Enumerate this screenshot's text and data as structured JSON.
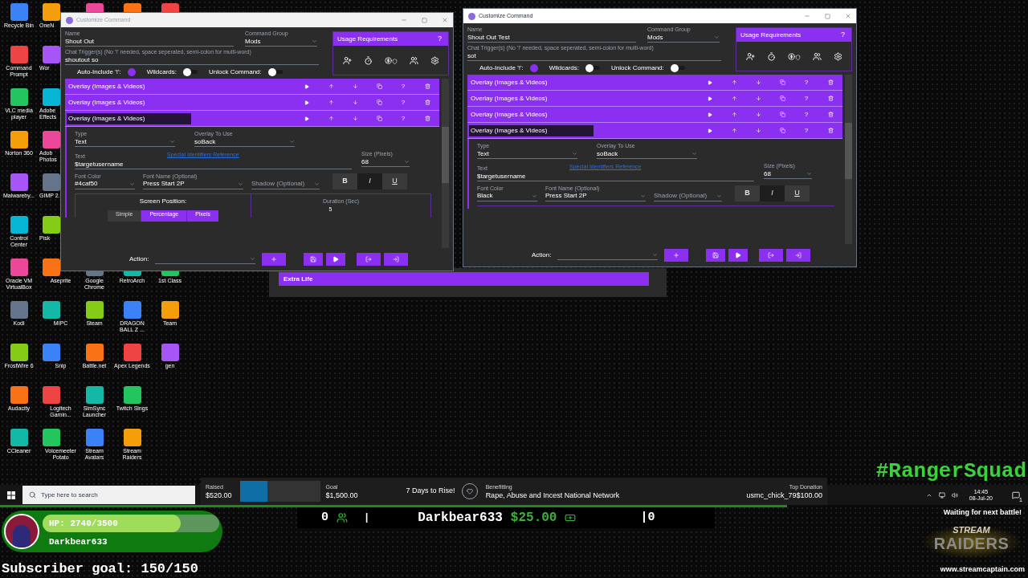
{
  "desktop_columns": [
    [
      {
        "label": "Recycle Bin"
      },
      {
        "label": "Command Prompt"
      },
      {
        "label": "VLC media player"
      },
      {
        "label": "Norton 360"
      },
      {
        "label": "Malwareby..."
      },
      {
        "label": "Control Center"
      },
      {
        "label": "Oracle VM VirtualBox"
      },
      {
        "label": "Kodi"
      },
      {
        "label": "FrostWire 6"
      },
      {
        "label": "Audacity"
      },
      {
        "label": "CCleaner"
      }
    ],
    [
      {
        "label": "OneN"
      },
      {
        "label": "Wor"
      },
      {
        "label": "Adobe Effects"
      },
      {
        "label": "Adob Photos"
      },
      {
        "label": "GIMP 2."
      },
      {
        "label": "Pisk"
      },
      {
        "label": "Aseprite"
      },
      {
        "label": "MIPC"
      },
      {
        "label": "Snip"
      },
      {
        "label": "Logitech Gamin..."
      },
      {
        "label": "Voicemeeter Potato"
      }
    ],
    [
      {},
      {
        "label": "Google Chrome"
      },
      {
        "label": "Steam"
      },
      {
        "label": "Battle.net"
      },
      {
        "label": "SimSync Launcher"
      },
      {
        "label": "Stream Avatars"
      }
    ],
    [
      {},
      {
        "label": "RetroArch"
      },
      {
        "label": "DRAGON BALL Z ..."
      },
      {
        "label": "Apex Legends"
      },
      {
        "label": "Twitch Sings"
      },
      {
        "label": "Stream Raiders"
      }
    ],
    [
      {},
      {
        "label": "1st Class"
      },
      {
        "label": "Team"
      },
      {
        "label": "gen"
      }
    ]
  ],
  "background_bar": {
    "label": "Extra Life"
  },
  "windows": [
    {
      "title": "Customize Command",
      "active": false,
      "name_label": "Name",
      "name": "Shout Out",
      "group_label": "Command Group",
      "group": "Mods",
      "trigger_label": "Chat Trigger(s) (No '!' needed, space seperated, semi-colon for multi-word)",
      "triggers": "shoutout so",
      "toggles": [
        {
          "label": "Auto-Include '!':",
          "on": true
        },
        {
          "label": "Wildcards:",
          "on": false
        },
        {
          "label": "Unlock Command:",
          "on": false
        }
      ],
      "usage_title": "Usage Requirements",
      "usage_help": "?",
      "actions": [
        {
          "label": "Overlay (Images & Videos)",
          "selected": false,
          "help": "?"
        },
        {
          "label": "Overlay (Images & Videos)",
          "selected": false,
          "help": "?"
        },
        {
          "label": "Overlay (Images & Videos)",
          "selected": true,
          "help": "?"
        }
      ],
      "detail": {
        "type_label": "Type",
        "type": "Text",
        "overlay_label": "Overlay To Use",
        "overlay": "soBack",
        "text_label": "Text",
        "text": "$targetusername",
        "link": "Special Identifiers Reference",
        "size_label": "Size (Pixels)",
        "size": "68",
        "color_label": "Font Color",
        "font_color": "#4caf50",
        "font_label": "Font Name (Optional)",
        "font": "Press Start 2P",
        "shadow_placeholder": "Shadow (Optional)",
        "format_buttons": [
          {
            "label": "B",
            "selected": false
          },
          {
            "label": "I",
            "selected": true
          },
          {
            "label": "U",
            "selected": false
          }
        ],
        "position": {
          "label": "Screen Position:",
          "modes": [
            {
              "label": "Simple",
              "disabled": true
            },
            {
              "label": "Percentage",
              "disabled": false
            },
            {
              "label": "Pixels",
              "disabled": false
            }
          ],
          "duration_label": "Duration (Sec)",
          "duration": "5"
        }
      },
      "action_label": "Action:"
    },
    {
      "title": "Customize Command",
      "active": true,
      "name_label": "Name",
      "name": "Shout Out Test",
      "group_label": "Command Group",
      "group": "Mods",
      "trigger_label": "Chat Trigger(s) (No '!' needed, space seperated, semi-colon for multi-word)",
      "triggers": "sot",
      "toggles": [
        {
          "label": "Auto-Include '!':",
          "on": true
        },
        {
          "label": "Wildcards:",
          "on": false
        },
        {
          "label": "Unlock Command:",
          "on": false
        }
      ],
      "usage_title": "Usage Requirements",
      "usage_help": "?",
      "actions": [
        {
          "label": "Overlay (Images & Videos)",
          "selected": false,
          "help": "?"
        },
        {
          "label": "Overlay (Images & Videos)",
          "selected": false,
          "help": "?"
        },
        {
          "label": "Overlay (Images & Videos)",
          "selected": false,
          "help": "?"
        },
        {
          "label": "Overlay (Images & Videos)",
          "selected": true,
          "help": "?"
        }
      ],
      "detail": {
        "type_label": "Type",
        "type": "Text",
        "overlay_label": "Overlay To Use",
        "overlay": "soBack",
        "text_label": "Text",
        "text": "$targetusername",
        "link": "Special Identifiers Reference",
        "size_label": "Size (Pixels)",
        "size": "68",
        "color_label": "Font Color",
        "font_color": "Black",
        "font_label": "Font Name (Optional)",
        "font": "Press Start 2P",
        "shadow_placeholder": "Shadow (Optional)",
        "format_buttons": [
          {
            "label": "B",
            "selected": false
          },
          {
            "label": "I",
            "selected": true
          },
          {
            "label": "U",
            "selected": false
          }
        ]
      },
      "action_label": "Action:"
    }
  ],
  "taskbar": {
    "search_placeholder": "Type here to search",
    "time": "14:45",
    "date": "08-Jul-20",
    "notification_count": "1"
  },
  "donation": {
    "raised_label": "Raised",
    "raised": "$520.00",
    "level": 0.34,
    "goal_label": "Goal",
    "goal": "$1,500.00",
    "campaign": "7 Days to Rise!",
    "benefit_label": "Benefitting",
    "charity": "Rape, Abuse and Incest National Network",
    "top_label": "Top Donation",
    "top_donation": "usmc_chick_79$100.00"
  },
  "player": {
    "hp": "HP: 2740/3500",
    "level": 0.78,
    "name": "Darkbear633"
  },
  "subscriber_goal": "Subscriber goal: 150/150",
  "ticker": {
    "viewers": "0",
    "separator": "|",
    "donor": "Darkbear633",
    "amount": "$25.00",
    "count": "|0"
  },
  "hashtag": "#RangerSquad",
  "battle_status": "Waiting for next battle!",
  "logo": {
    "top": "STREAM",
    "bottom": "RAIDERS"
  },
  "website": "www.streamcaptain.com"
}
